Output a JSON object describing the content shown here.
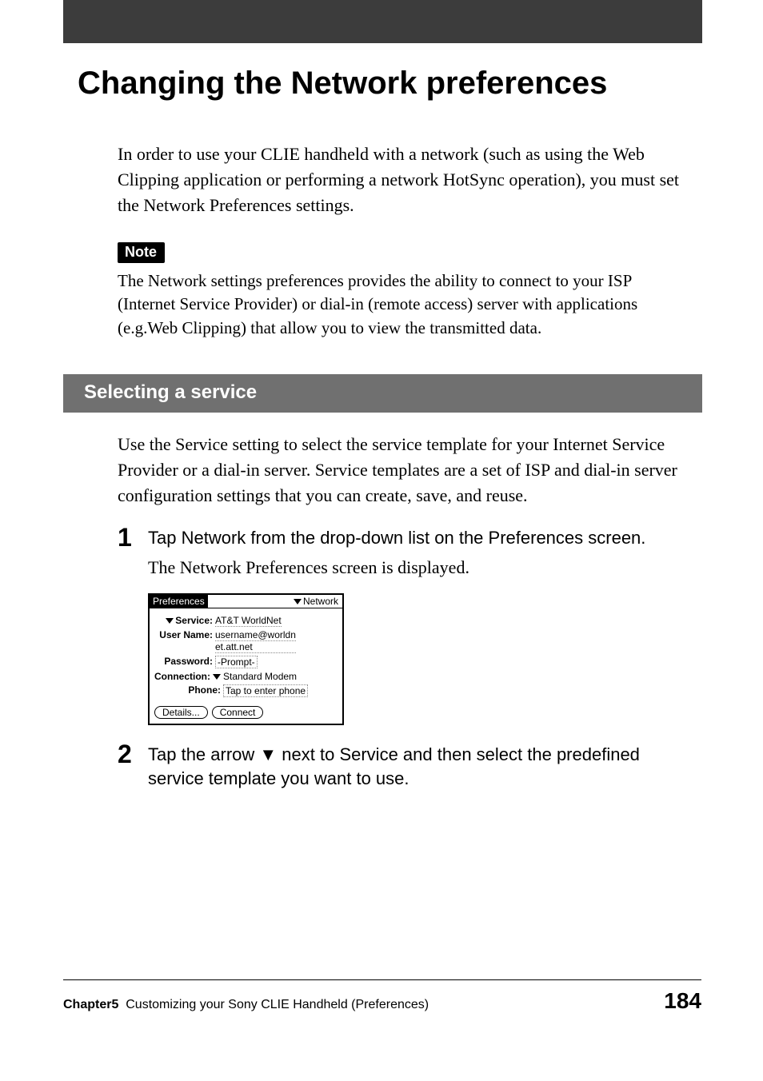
{
  "page_title": "Changing the Network preferences",
  "intro": "In order to use your CLIE handheld with a network (such as using the Web Clipping application or performing a network HotSync operation), you must set the Network Preferences settings.",
  "note_label": "Note",
  "note_text": "The Network settings preferences provides the ability to connect to your ISP (Internet Service Provider) or dial-in (remote access) server with applications (e.g.Web Clipping) that allow you to view the transmitted data.",
  "section_heading": "Selecting a service",
  "section_intro": "Use the Service setting to select the service template for your Internet Service Provider or a dial-in server. Service templates are a set of ISP and dial-in server configuration settings that you can create, save, and reuse.",
  "steps": [
    {
      "num": "1",
      "bold": "Tap Network from the drop-down list on the Preferences screen.",
      "plain": "The Network Preferences screen is displayed."
    },
    {
      "num": "2",
      "bold": "Tap the arrow ▼ next to Service and then select the predefined service template you want to use.",
      "plain": ""
    }
  ],
  "mock": {
    "title": "Preferences",
    "menu": "Network",
    "service_label": "Service:",
    "service_value": "AT&T WorldNet",
    "username_label": "User Name:",
    "username_value1": "username@worldn",
    "username_value2": "et.att.net",
    "password_label": "Password:",
    "password_value": "-Prompt-",
    "connection_label": "Connection:",
    "connection_value": "Standard Modem",
    "phone_label": "Phone:",
    "phone_value": "Tap to enter phone",
    "btn_details": "Details...",
    "btn_connect": "Connect"
  },
  "footer": {
    "chapter_label": "Chapter5",
    "chapter_title": "Customizing your Sony CLIE Handheld (Preferences)",
    "page_number": "184"
  }
}
